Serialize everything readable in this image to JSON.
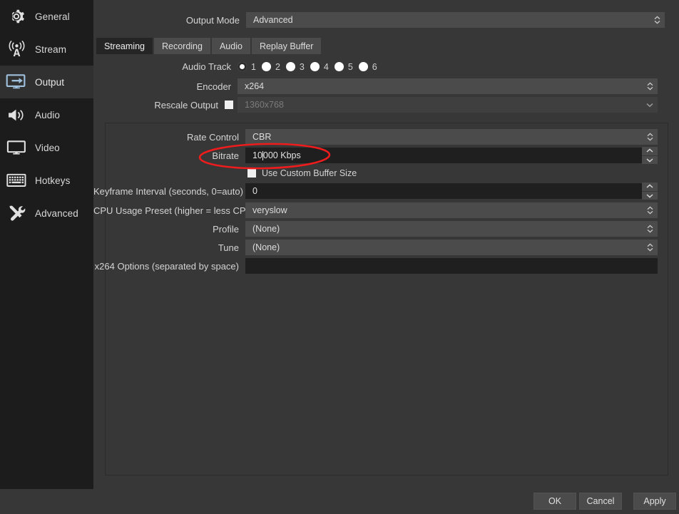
{
  "sidebar": {
    "items": [
      {
        "label": "General",
        "icon": "gear-icon",
        "active": false
      },
      {
        "label": "Stream",
        "icon": "broadcast-icon",
        "active": false
      },
      {
        "label": "Output",
        "icon": "monitor-arrow-icon",
        "active": true
      },
      {
        "label": "Audio",
        "icon": "speaker-icon",
        "active": false
      },
      {
        "label": "Video",
        "icon": "display-icon",
        "active": false
      },
      {
        "label": "Hotkeys",
        "icon": "keyboard-icon",
        "active": false
      },
      {
        "label": "Advanced",
        "icon": "tools-icon",
        "active": false
      }
    ]
  },
  "output_mode": {
    "label": "Output Mode",
    "value": "Advanced"
  },
  "tabs": [
    {
      "label": "Streaming",
      "active": true
    },
    {
      "label": "Recording",
      "active": false
    },
    {
      "label": "Audio",
      "active": false
    },
    {
      "label": "Replay Buffer",
      "active": false
    }
  ],
  "audio_track": {
    "label": "Audio Track",
    "options": [
      "1",
      "2",
      "3",
      "4",
      "5",
      "6"
    ],
    "selected": "1"
  },
  "encoder": {
    "label": "Encoder",
    "value": "x264"
  },
  "rescale_output": {
    "label": "Rescale Output",
    "checked": false,
    "value": "1360x768",
    "enabled": false
  },
  "rate_control": {
    "label": "Rate Control",
    "value": "CBR"
  },
  "bitrate": {
    "label": "Bitrate",
    "value": "10000 Kbps"
  },
  "custom_buffer": {
    "label": "Use Custom Buffer Size",
    "checked": false
  },
  "keyframe_interval": {
    "label": "Keyframe Interval (seconds, 0=auto)",
    "value": "0"
  },
  "cpu_preset": {
    "label": "CPU Usage Preset (higher = less CPU)",
    "value": "veryslow"
  },
  "profile": {
    "label": "Profile",
    "value": "(None)"
  },
  "tune": {
    "label": "Tune",
    "value": "(None)"
  },
  "x264_options": {
    "label": "x264 Options (separated by space)",
    "value": ""
  },
  "dialog_buttons": {
    "ok": "OK",
    "cancel": "Cancel",
    "apply": "Apply"
  },
  "annotation": {
    "shape": "red-ellipse",
    "color": "#ee1c1c",
    "targets": "Bitrate row"
  }
}
